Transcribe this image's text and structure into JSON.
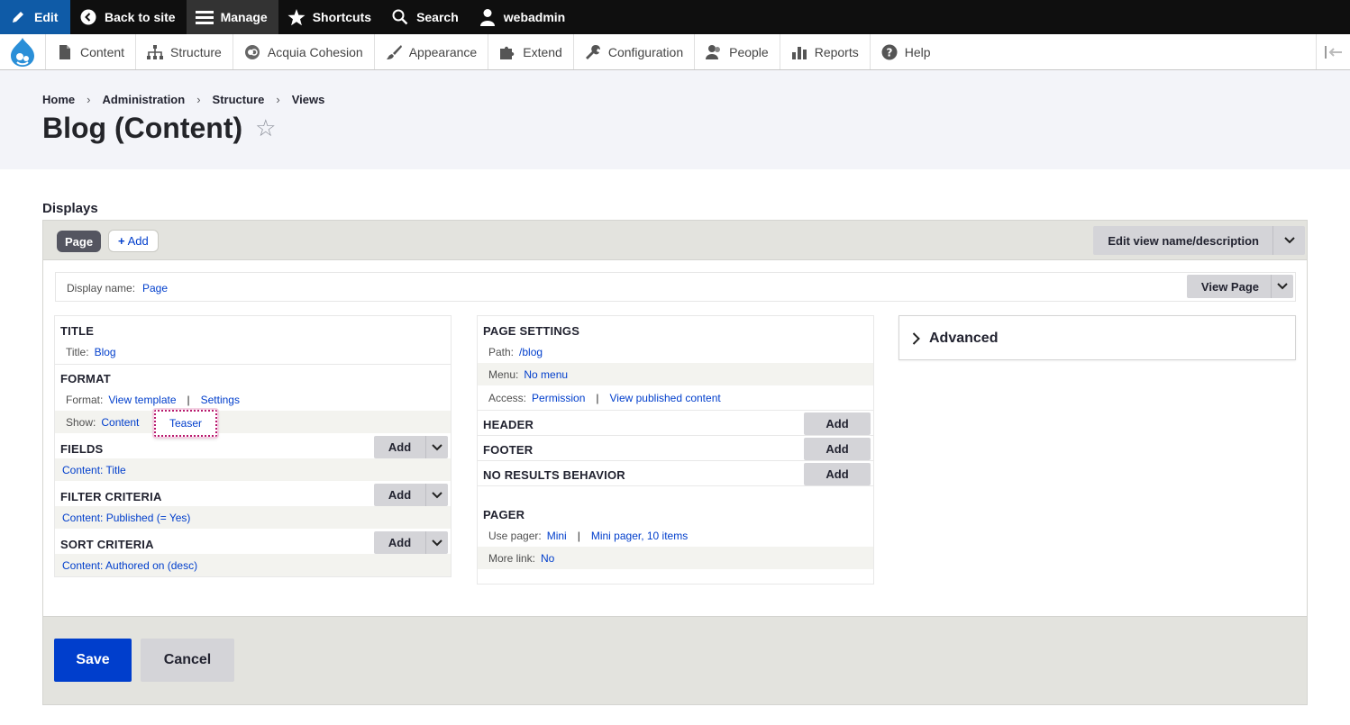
{
  "toolbar": {
    "edit": "Edit",
    "back_to_site": "Back to site",
    "manage": "Manage",
    "shortcuts": "Shortcuts",
    "search": "Search",
    "user": "webadmin"
  },
  "tray": {
    "items": [
      "Content",
      "Structure",
      "Acquia Cohesion",
      "Appearance",
      "Extend",
      "Configuration",
      "People",
      "Reports",
      "Help"
    ]
  },
  "breadcrumb": [
    "Home",
    "Administration",
    "Structure",
    "Views"
  ],
  "page_title": "Blog (Content)",
  "displays": {
    "label": "Displays",
    "tab_page": "Page",
    "tab_add": "Add",
    "edit_name": "Edit view name/description",
    "display_name_label": "Display name:",
    "display_name_value": "Page",
    "view_page": "View Page"
  },
  "column1": {
    "title_heading": "TITLE",
    "title_label": "Title:",
    "title_value": "Blog",
    "format_heading": "FORMAT",
    "format_label": "Format:",
    "format_template": "View template",
    "format_settings": "Settings",
    "show_label": "Show:",
    "show_content": "Content",
    "show_teaser": "Teaser",
    "fields_heading": "FIELDS",
    "fields_value": "Content: Title",
    "filter_heading": "FILTER CRITERIA",
    "filter_value": "Content: Published (= Yes)",
    "sort_heading": "SORT CRITERIA",
    "sort_value": "Content: Authored on (desc)",
    "add_label": "Add"
  },
  "column2": {
    "page_settings_heading": "PAGE SETTINGS",
    "path_label": "Path:",
    "path_value": "/blog",
    "menu_label": "Menu:",
    "menu_value": "No menu",
    "access_label": "Access:",
    "access_permission": "Permission",
    "access_value": "View published content",
    "header_heading": "HEADER",
    "footer_heading": "FOOTER",
    "no_results_heading": "NO RESULTS BEHAVIOR",
    "add_label": "Add",
    "pager_heading": "PAGER",
    "use_pager_label": "Use pager:",
    "use_pager_value": "Mini",
    "pager_detail": "Mini pager, 10 items",
    "more_link_label": "More link:",
    "more_link_value": "No"
  },
  "column3": {
    "advanced": "Advanced"
  },
  "footer": {
    "save": "Save",
    "cancel": "Cancel"
  },
  "icons": {
    "edit": "pencil-icon",
    "back": "chevron-circle-left-icon",
    "manage": "hamburger-icon",
    "shortcuts": "star-icon",
    "search": "search-icon",
    "user": "user-icon",
    "logo": "drupal-drop-icon"
  },
  "colors": {
    "link": "#003ecc",
    "primary_button": "#003ecc",
    "toolbar": "#0f0f0f",
    "edit_tab": "#0f5ba7",
    "focus_outline": "#b8196d"
  }
}
